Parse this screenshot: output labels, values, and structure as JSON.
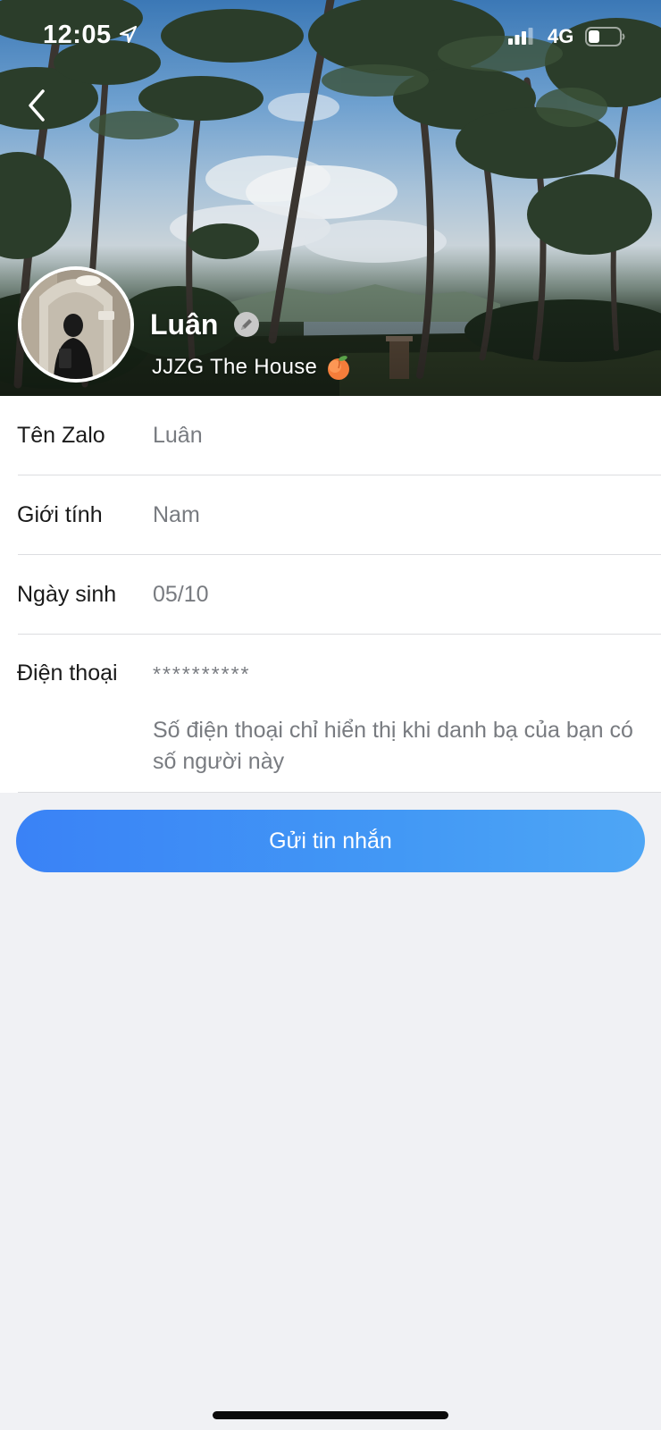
{
  "status_bar": {
    "time": "12:05",
    "network": "4G",
    "icons": [
      "location-arrow-icon",
      "signal-icon",
      "battery-icon"
    ]
  },
  "header": {
    "back_icon": "chevron-left-icon",
    "name": "Luân",
    "status": "JJZG The House",
    "status_emoji_icon": "peach-icon",
    "edit_icon": "pencil-icon"
  },
  "info": {
    "zalo_name": {
      "label": "Tên Zalo",
      "value": "Luân"
    },
    "gender": {
      "label": "Giới tính",
      "value": "Nam"
    },
    "birthday": {
      "label": "Ngày sinh",
      "value": "05/10"
    },
    "phone": {
      "label": "Điện thoại",
      "value": "**********",
      "note": "Số điện thoại chỉ hiển thị khi danh bạ của bạn có số người này"
    }
  },
  "actions": {
    "send_message_label": "Gửi tin nhắn"
  },
  "colors": {
    "accent": "#3a82f6",
    "background": "#f0f1f4",
    "label_text": "#1a1a1a",
    "value_text": "#787b80"
  }
}
